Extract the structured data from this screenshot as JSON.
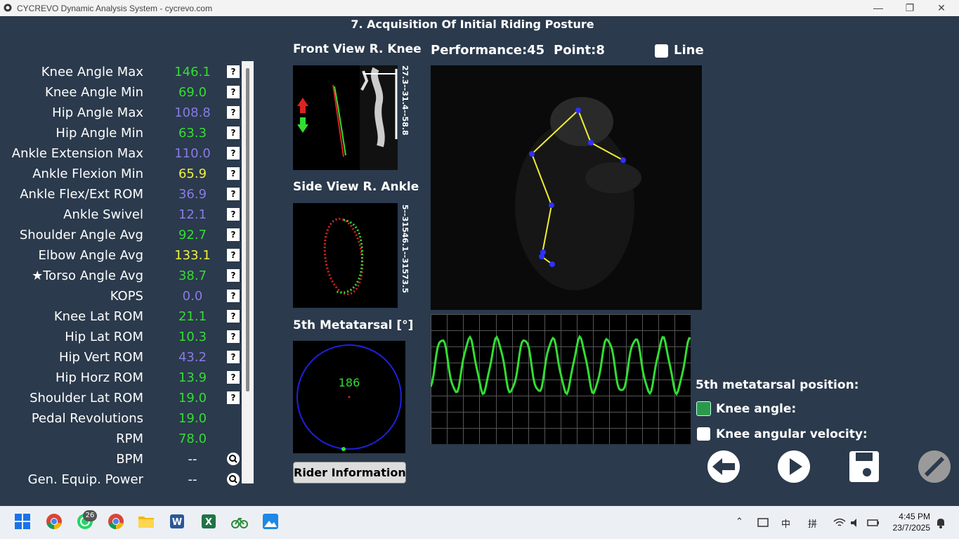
{
  "window": {
    "title": "CYCREVO Dynamic Analysis System - cycrevo.com"
  },
  "heading": "7. Acquisition Of Initial Riding Posture",
  "colors": {
    "green": "#33dd33",
    "purple": "#8a7ae8",
    "yellow": "#f0f040",
    "red": "#dd2222"
  },
  "metrics": [
    {
      "label": "Knee Angle Max",
      "value": "146.1",
      "color": "green",
      "icon": "help-icon"
    },
    {
      "label": "Knee Angle Min",
      "value": "69.0",
      "color": "green",
      "icon": "help-icon"
    },
    {
      "label": "Hip Angle Max",
      "value": "108.8",
      "color": "purple",
      "icon": "help-icon"
    },
    {
      "label": "Hip Angle Min",
      "value": "63.3",
      "color": "green",
      "icon": "help-icon"
    },
    {
      "label": "Ankle Extension Max",
      "value": "110.0",
      "color": "purple",
      "icon": "help-icon"
    },
    {
      "label": "Ankle Flexion Min",
      "value": "65.9",
      "color": "yellow",
      "icon": "help-icon"
    },
    {
      "label": "Ankle Flex/Ext ROM",
      "value": "36.9",
      "color": "purple",
      "icon": "help-icon"
    },
    {
      "label": "Ankle Swivel",
      "value": "12.1",
      "color": "purple",
      "icon": "help-icon"
    },
    {
      "label": "Shoulder Angle Avg",
      "value": "92.7",
      "color": "green",
      "icon": "help-icon"
    },
    {
      "label": "Elbow Angle Avg",
      "value": "133.1",
      "color": "yellow",
      "icon": "help-icon"
    },
    {
      "label": "★Torso Angle Avg",
      "value": "38.7",
      "color": "green",
      "icon": "help-icon"
    },
    {
      "label": "KOPS",
      "value": "0.0",
      "color": "purple",
      "icon": "help-icon"
    },
    {
      "label": "Knee Lat ROM",
      "value": "21.1",
      "color": "green",
      "icon": "help-icon"
    },
    {
      "label": "Hip Lat ROM",
      "value": "10.3",
      "color": "green",
      "icon": "help-icon"
    },
    {
      "label": "Hip Vert ROM",
      "value": "43.2",
      "color": "purple",
      "icon": "help-icon"
    },
    {
      "label": "Hip Horz ROM",
      "value": "13.9",
      "color": "green",
      "icon": "help-icon"
    },
    {
      "label": "Shoulder Lat ROM",
      "value": "19.0",
      "color": "green",
      "icon": "help-icon"
    },
    {
      "label": "Pedal Revolutions",
      "value": "19.0",
      "color": "green",
      "icon": "none"
    },
    {
      "label": "RPM",
      "value": "78.0",
      "color": "green",
      "icon": "none"
    },
    {
      "label": "BPM",
      "value": "--",
      "color": "white",
      "icon": "magnifier-icon"
    },
    {
      "label": "Gen. Equip. Power",
      "value": "--",
      "color": "white",
      "icon": "magnifier-icon"
    }
  ],
  "help_glyph": "?",
  "front_view": {
    "title": "Front View R. Knee",
    "scale": "27.3--31.4--58.8"
  },
  "side_view": {
    "title": "Side View R. Ankle",
    "scale": "5--31546.1--31573.5"
  },
  "metatarsal": {
    "title": "5th Metatarsal [°]",
    "value": "186"
  },
  "rider_button": "Rider Information",
  "performance": {
    "label": "Performance:45",
    "point": "Point:8"
  },
  "line_toggle": {
    "label": "Line",
    "checked": false
  },
  "legend": {
    "title": "5th metatarsal position:",
    "knee_angle": {
      "label": "Knee angle:",
      "checked": true
    },
    "knee_velocity": {
      "label": "Knee angular velocity:",
      "checked": false
    }
  },
  "controls": [
    "back-arrow-icon",
    "play-icon",
    "save-icon",
    "disabled-slash-icon"
  ],
  "taskbar": {
    "whatsapp_badge": "26",
    "time": "4:45 PM",
    "date": "23/7/2025",
    "ime": "中",
    "ime2": "拼"
  }
}
